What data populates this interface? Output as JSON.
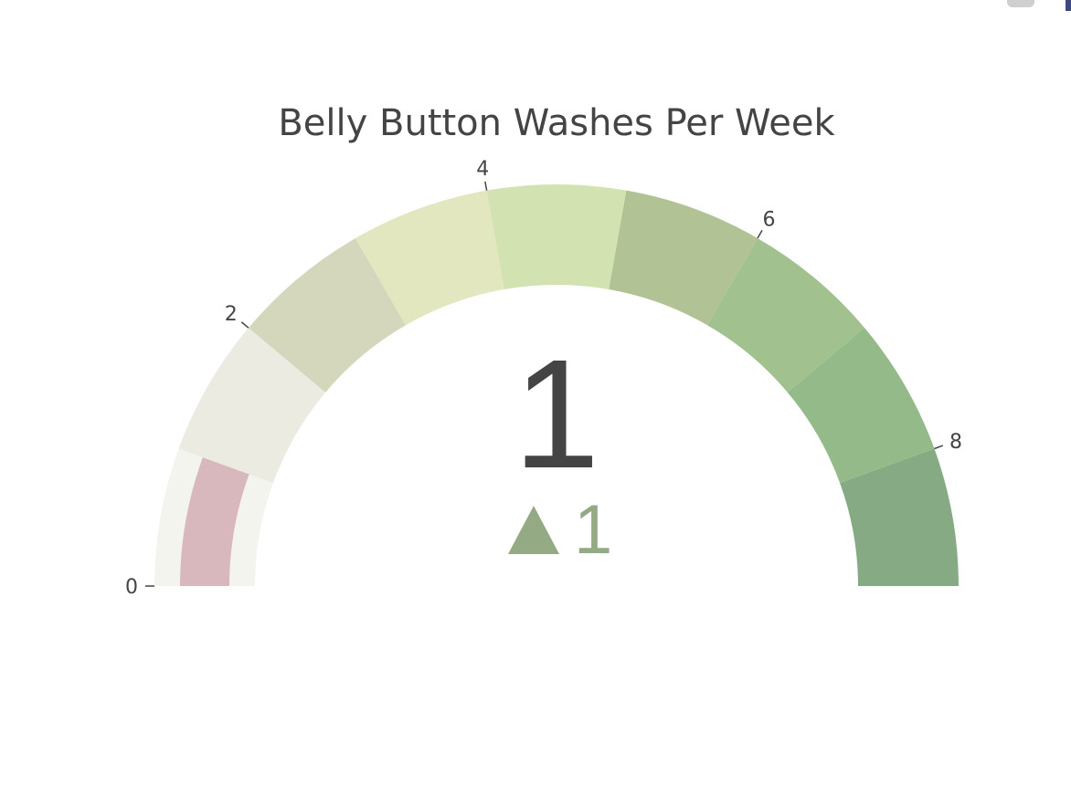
{
  "chart_data": {
    "type": "gauge",
    "title": "Belly Button Washes Per Week",
    "value": 1,
    "delta": {
      "reference": 0,
      "value": 1,
      "display": "1",
      "direction": "increasing"
    },
    "axis_range": [
      0,
      9
    ],
    "ticks": [
      {
        "value": 0,
        "label": "0"
      },
      {
        "value": 2,
        "label": "2"
      },
      {
        "value": 4,
        "label": "4"
      },
      {
        "value": 6,
        "label": "6"
      },
      {
        "value": 8,
        "label": "8"
      }
    ],
    "bar_color": "#d8b8bd",
    "bgcolor": "#f4f4ef",
    "steps": [
      {
        "range": [
          0,
          1
        ],
        "color": "#f4f4ef"
      },
      {
        "range": [
          1,
          2
        ],
        "color": "#ebebe2"
      },
      {
        "range": [
          2,
          3
        ],
        "color": "#d5d7bd"
      },
      {
        "range": [
          3,
          4
        ],
        "color": "#e2e7bf"
      },
      {
        "range": [
          4,
          5
        ],
        "color": "#d2e2b1"
      },
      {
        "range": [
          5,
          6
        ],
        "color": "#b1c294"
      },
      {
        "range": [
          6,
          7
        ],
        "color": "#a1c18f"
      },
      {
        "range": [
          7,
          8
        ],
        "color": "#94ba8a"
      },
      {
        "range": [
          8,
          9
        ],
        "color": "#86ab84"
      }
    ],
    "number_color": "#444444",
    "delta_color": "#93aa84"
  }
}
